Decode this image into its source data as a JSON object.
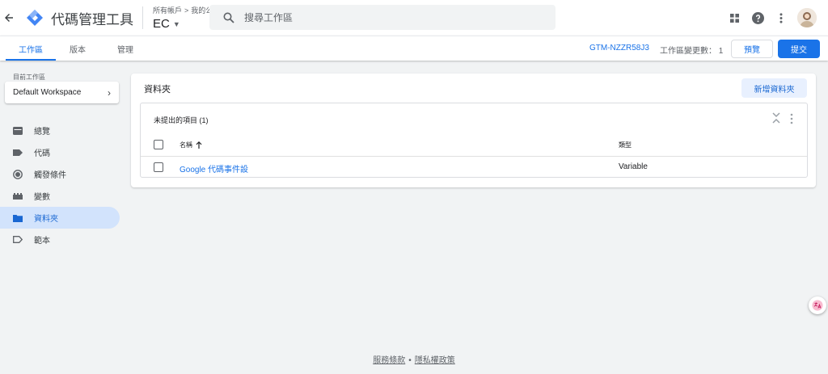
{
  "header": {
    "title": "代碼管理工具",
    "breadcrumb": {
      "accounts": "所有帳戶",
      "separator": ">",
      "company": "我的公司"
    },
    "container": "EC",
    "search_placeholder": "搜尋工作區"
  },
  "tabs": [
    {
      "label": "工作區",
      "active": true
    },
    {
      "label": "版本",
      "active": false
    },
    {
      "label": "管理",
      "active": false
    }
  ],
  "toolbar": {
    "container_id": "GTM-NZZR58J3",
    "workspace_changes": "工作區變更數： 1",
    "preview_label": "預覽",
    "submit_label": "提交"
  },
  "sidebar": {
    "workspace_label": "目前工作區",
    "workspace_name": "Default Workspace",
    "items": [
      {
        "label": "總覽",
        "icon": "overview-icon"
      },
      {
        "label": "代碼",
        "icon": "tag-icon"
      },
      {
        "label": "觸發條件",
        "icon": "trigger-icon"
      },
      {
        "label": "變數",
        "icon": "variable-icon"
      },
      {
        "label": "資料夾",
        "icon": "folder-icon",
        "active": true
      },
      {
        "label": "範本",
        "icon": "template-icon"
      }
    ]
  },
  "main": {
    "title": "資料夾",
    "new_folder_label": "新增資料夾",
    "folder": {
      "title": "未提出的項目 (1)",
      "columns": {
        "name": "名稱",
        "type": "類型"
      },
      "rows": [
        {
          "name": "Google 代碼事件設",
          "type": "Variable"
        }
      ]
    }
  },
  "footer": {
    "terms": "服務條款",
    "dot": "•",
    "privacy": "隱私權政策"
  },
  "colors": {
    "accent": "#1a73e8",
    "active_nav_bg": "#d2e3fc",
    "page_bg": "#f1f3f4"
  }
}
